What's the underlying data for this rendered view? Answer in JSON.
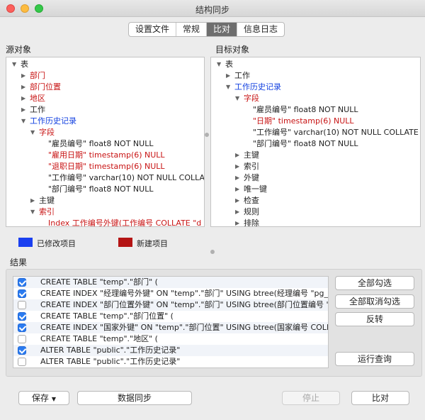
{
  "window": {
    "title": "结构同步"
  },
  "tabs": [
    {
      "label": "设置文件",
      "active": false
    },
    {
      "label": "常规",
      "active": false
    },
    {
      "label": "比对",
      "active": true
    },
    {
      "label": "信息日志",
      "active": false
    }
  ],
  "source": {
    "label": "源对象",
    "tree": [
      {
        "text": "表",
        "expanded": true,
        "color": "normal"
      },
      {
        "text": "部门",
        "expanded": false,
        "color": "red"
      },
      {
        "text": "部门位置",
        "expanded": false,
        "color": "red"
      },
      {
        "text": "地区",
        "expanded": false,
        "color": "red"
      },
      {
        "text": "工作",
        "expanded": false,
        "color": "normal"
      },
      {
        "text": "工作历史记录",
        "expanded": true,
        "color": "blue"
      },
      {
        "text": "字段",
        "expanded": true,
        "color": "red"
      },
      {
        "text": "\"雇员编号\" float8 NOT NULL",
        "color": "normal"
      },
      {
        "text": "\"雇用日期\" timestamp(6) NULL",
        "color": "red"
      },
      {
        "text": "\"退职日期\" timestamp(6) NULL",
        "color": "red"
      },
      {
        "text": "\"工作编号\" varchar(10) NOT NULL COLLATE",
        "color": "normal"
      },
      {
        "text": "\"部门编号\" float8 NOT NULL",
        "color": "normal"
      },
      {
        "text": "主键",
        "expanded": false,
        "color": "normal"
      },
      {
        "text": "索引",
        "expanded": true,
        "color": "red"
      },
      {
        "text": "Index 工作编号外键(工作编号 COLLATE \"d",
        "color": "red"
      }
    ]
  },
  "target": {
    "label": "目标对象",
    "tree": [
      {
        "text": "表",
        "expanded": true,
        "color": "normal"
      },
      {
        "text": "工作",
        "expanded": false,
        "color": "normal"
      },
      {
        "text": "工作历史记录",
        "expanded": true,
        "color": "blue"
      },
      {
        "text": "字段",
        "expanded": true,
        "color": "red"
      },
      {
        "text": "\"雇员编号\" float8 NOT NULL",
        "color": "normal"
      },
      {
        "text": "\"日期\" timestamp(6) NULL",
        "color": "red"
      },
      {
        "text": "\"工作编号\" varchar(10) NOT NULL COLLATE",
        "color": "normal"
      },
      {
        "text": "\"部门编号\" float8 NOT NULL",
        "color": "normal"
      },
      {
        "text": "主键",
        "expanded": false,
        "color": "normal"
      },
      {
        "text": "索引",
        "expanded": false,
        "color": "normal"
      },
      {
        "text": "外键",
        "expanded": false,
        "color": "normal"
      },
      {
        "text": "唯一键",
        "expanded": false,
        "color": "normal"
      },
      {
        "text": "检查",
        "expanded": false,
        "color": "normal"
      },
      {
        "text": "规则",
        "expanded": false,
        "color": "normal"
      },
      {
        "text": "排除",
        "expanded": false,
        "color": "normal"
      }
    ]
  },
  "legend": {
    "modified_label": "已修改项目",
    "modified_color": "#1a3ff0",
    "new_label": "新建项目",
    "new_color": "#b41414"
  },
  "results": {
    "label": "结果",
    "rows": [
      {
        "checked": true,
        "text": "CREATE TABLE \"temp\".\"部门\" ("
      },
      {
        "checked": true,
        "text": "CREATE INDEX \"经理编号外键\" ON \"temp\".\"部门\" USING btree(经理编号 \"pg_ca"
      },
      {
        "checked": false,
        "text": "CREATE INDEX \"部门位置外键\" ON \"temp\".\"部门\" USING btree(部门位置编号 \"p"
      },
      {
        "checked": true,
        "text": "CREATE TABLE \"temp\".\"部门位置\" ("
      },
      {
        "checked": true,
        "text": "CREATE INDEX \"国家外键\" ON \"temp\".\"部门位置\" USING btree(国家编号 COLLA"
      },
      {
        "checked": false,
        "text": "CREATE TABLE \"temp\".\"地区\" ("
      },
      {
        "checked": true,
        "text": "ALTER TABLE \"public\".\"工作历史记录\""
      },
      {
        "checked": false,
        "text": "ALTER TABLE \"public\".\"工作历史记录\""
      }
    ]
  },
  "buttons": {
    "select_all": "全部勾选",
    "deselect_all": "全部取消勾选",
    "invert": "反转",
    "run_query": "运行查询",
    "save": "保存",
    "data_sync": "数据同步",
    "stop": "停止",
    "compare": "比对"
  }
}
